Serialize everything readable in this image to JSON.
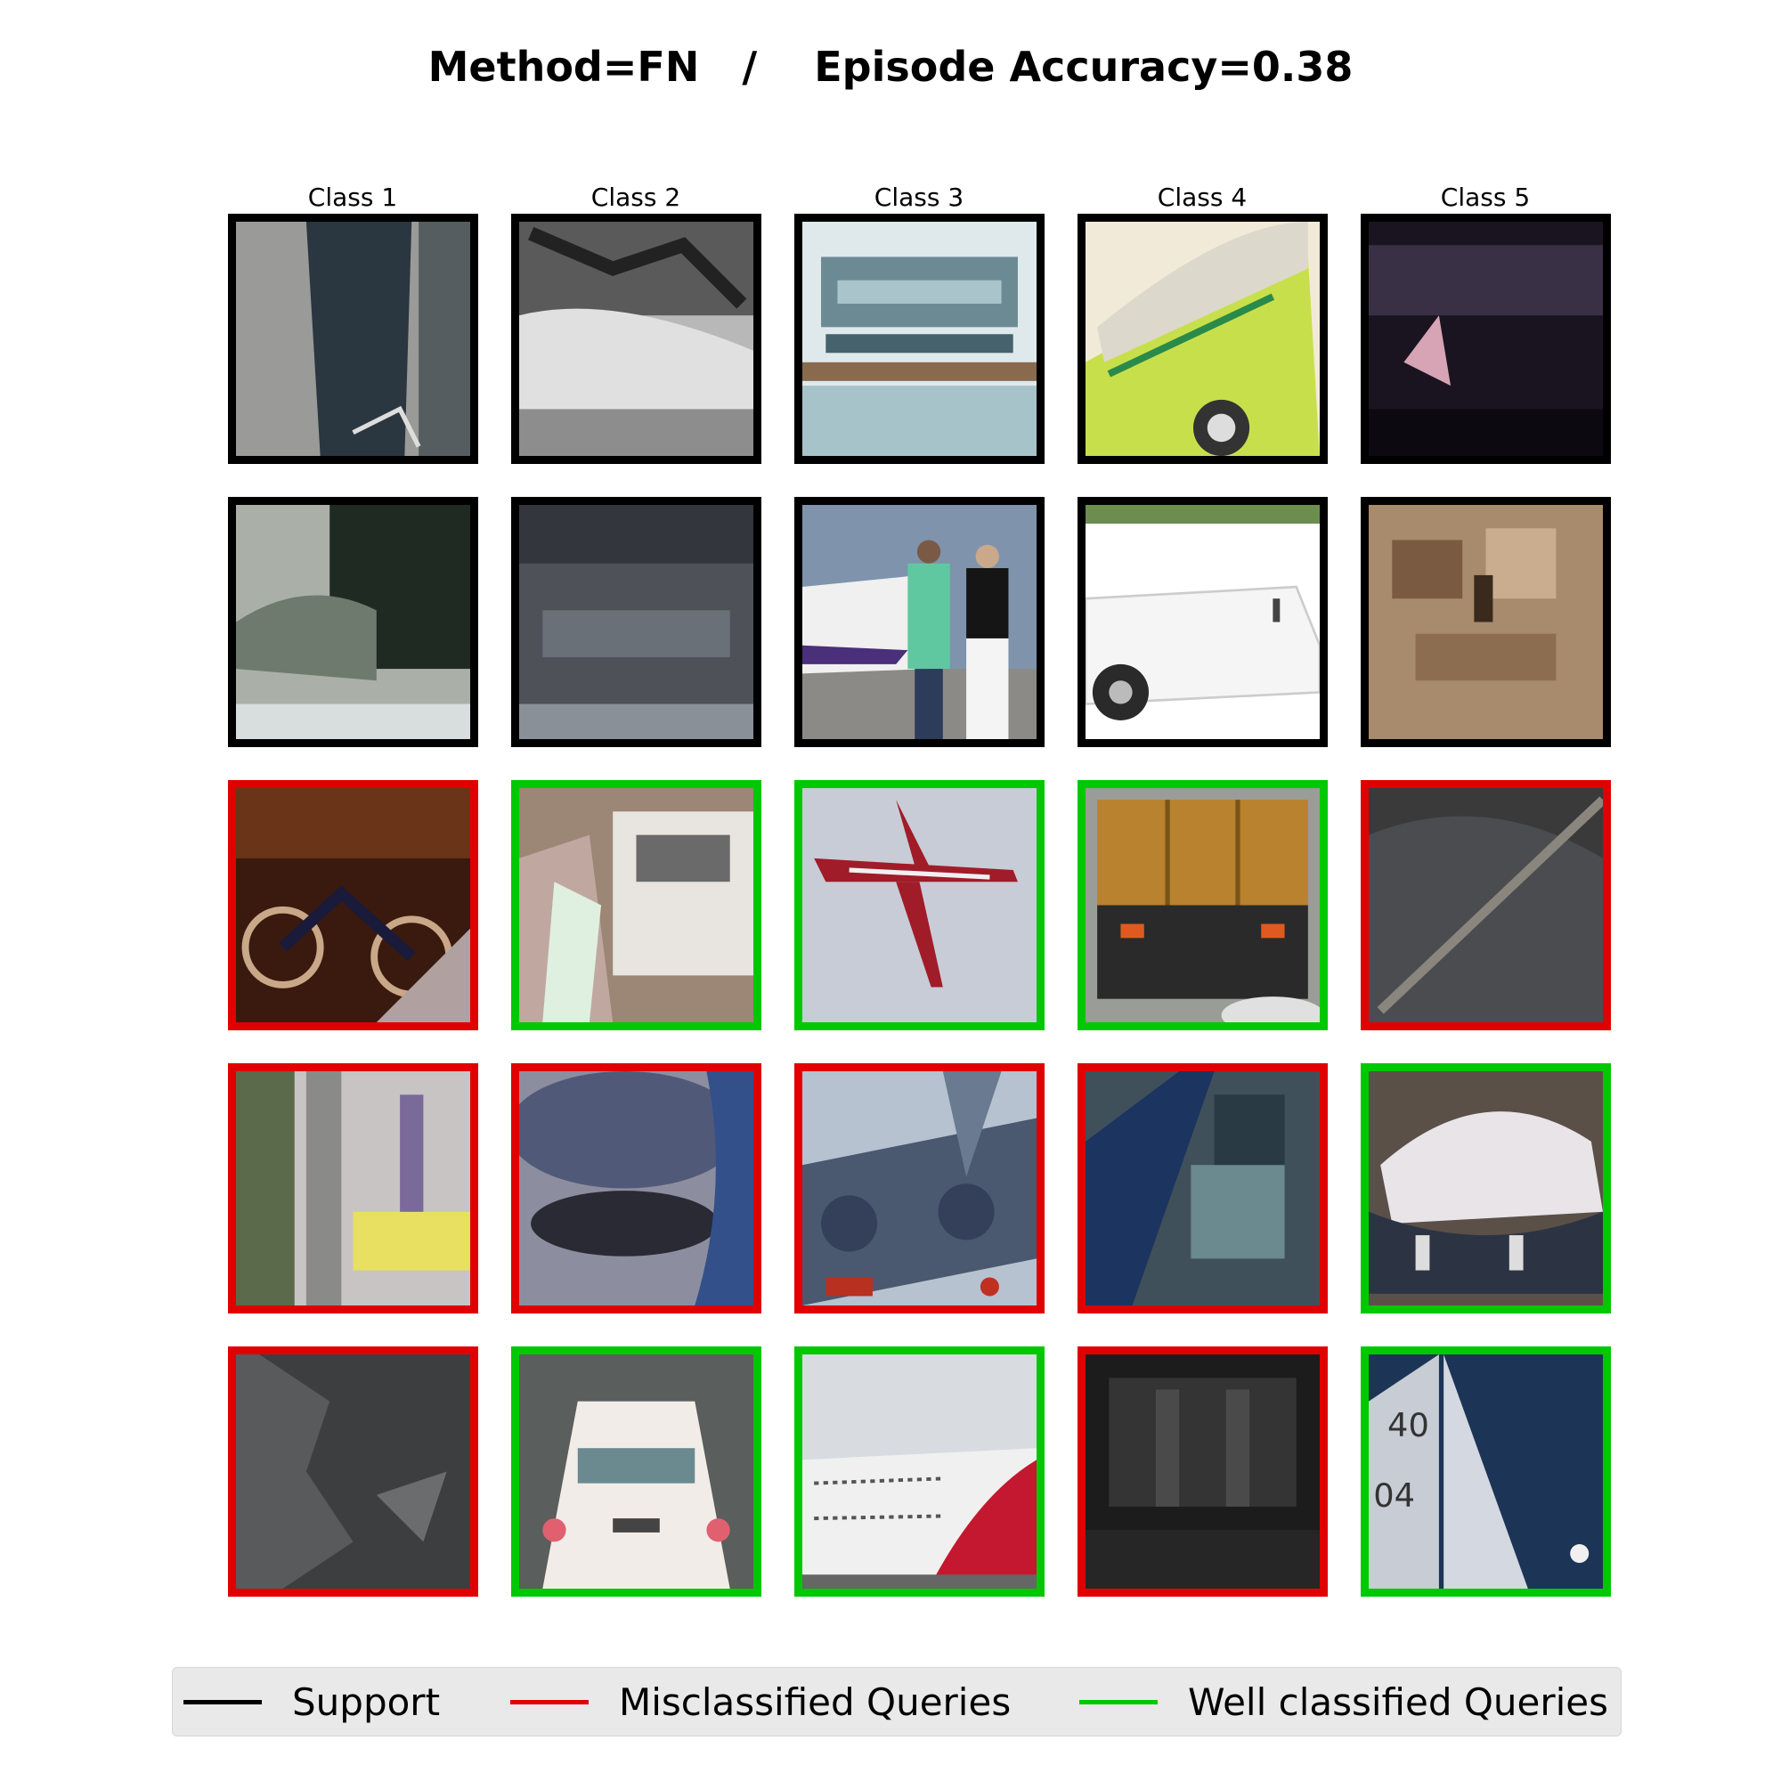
{
  "title": "Method=FN   /    Episode Accuracy=0.38",
  "columns": [
    "Class 1",
    "Class 2",
    "Class 3",
    "Class 4",
    "Class 5"
  ],
  "colors": {
    "support": "#000000",
    "misclassified": "#e00000",
    "well_classified": "#00c800"
  },
  "rows": [
    [
      "support",
      "support",
      "support",
      "support",
      "support"
    ],
    [
      "support",
      "support",
      "support",
      "support",
      "support"
    ],
    [
      "misclassified",
      "well_classified",
      "well_classified",
      "well_classified",
      "misclassified"
    ],
    [
      "misclassified",
      "misclassified",
      "misclassified",
      "misclassified",
      "well_classified"
    ],
    [
      "misclassified",
      "well_classified",
      "well_classified",
      "misclassified",
      "well_classified"
    ]
  ],
  "legend": [
    {
      "key": "support",
      "label": "Support"
    },
    {
      "key": "misclassified",
      "label": "Misclassified Queries"
    },
    {
      "key": "well_classified",
      "label": "Well classified Queries"
    }
  ]
}
